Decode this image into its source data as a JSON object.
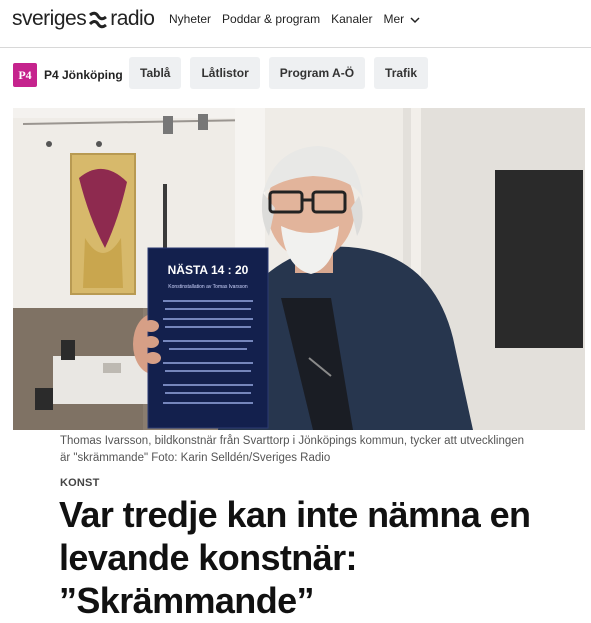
{
  "header": {
    "logo_left": "sveriges",
    "logo_right": "radio",
    "nav": [
      "Nyheter",
      "Poddar & program",
      "Kanaler",
      "Mer"
    ]
  },
  "channel": {
    "badge": "P4",
    "name": "P4 Jönköping",
    "badge_color": "#c5238d",
    "tabs": [
      "Tablå",
      "Låtlistor",
      "Program A-Ö",
      "Trafik"
    ]
  },
  "article": {
    "sign": {
      "title": "NÄSTA 14 : 20",
      "subtitle": "Konstinstallation av Tomas Ivarsson"
    },
    "caption": "Thomas Ivarsson, bildkonstnär från Svarttorp i Jönköpings kommun, tycker att utvecklingen är \"skrämmande\" Foto: Karin Selldén/Sveriges Radio",
    "kicker": "KONST",
    "headline": "Var tredje kan inte nämna en levande konstnär: ”Skrämmande”"
  }
}
